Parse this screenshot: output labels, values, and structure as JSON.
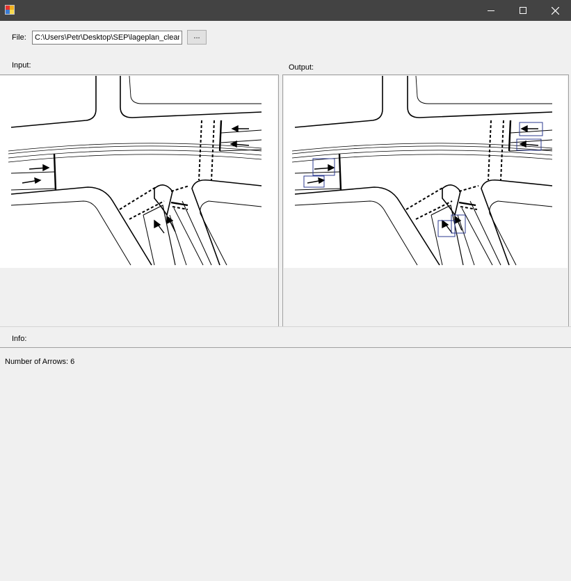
{
  "window": {
    "title": "",
    "icons": [
      "app-icon",
      "minimize-icon",
      "maximize-icon",
      "close-icon"
    ]
  },
  "file": {
    "label": "File:",
    "path": "C:\\Users\\Petr\\Desktop\\SEP\\lageplan_clean",
    "browse_label": "..."
  },
  "input_panel": {
    "label": "Input:"
  },
  "output_panel": {
    "label": "Output:"
  },
  "info": {
    "label": "Info:",
    "result_text": "Number of Arrows: 6"
  },
  "colors": {
    "titlebar": "#434343",
    "background": "#f0f0f0",
    "detection_box": "#2b3a8f"
  }
}
